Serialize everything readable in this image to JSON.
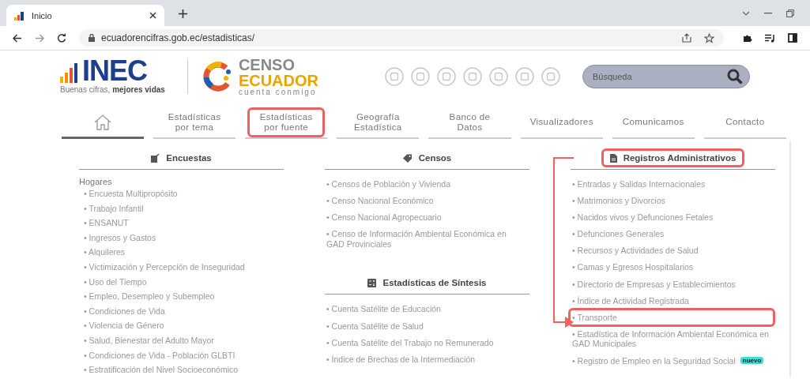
{
  "browser": {
    "tab_title": "Inicio",
    "url": "ecuadorencifras.gob.ec/estadisticas/"
  },
  "header": {
    "logo_text": "INEC",
    "slogan": "Buenas cifras, **mejores vidas**",
    "censo_line1": "CENSO",
    "censo_line2": "ECUADOR",
    "censo_tagline": "cuenta conmigo",
    "search": {
      "placeholder": "Búsqueda"
    }
  },
  "nav": [
    {
      "kind": "home",
      "selected": true
    },
    {
      "kind": "text",
      "label": "Estadísticas por tema",
      "selected": false,
      "highlighted": false
    },
    {
      "kind": "text",
      "label": "Estadísticas por fuente",
      "selected": false,
      "highlighted": true
    },
    {
      "kind": "text",
      "label": "Geografía Estadística",
      "selected": false,
      "highlighted": false
    },
    {
      "kind": "text",
      "label": "Banco de Datos",
      "selected": false,
      "highlighted": false
    },
    {
      "kind": "text",
      "label": "Visualizadores",
      "selected": false,
      "highlighted": false
    },
    {
      "kind": "text",
      "label": "Comunicamos",
      "selected": false,
      "highlighted": false
    },
    {
      "kind": "text",
      "label": "Contacto",
      "selected": false,
      "highlighted": false
    }
  ],
  "columns": [
    {
      "sections": [
        {
          "heading": "Encuestas",
          "highlighted": false,
          "group": "Hogares",
          "items": [
            {
              "label": "• Encuesta Multipropósito",
              "highlighted": false
            },
            {
              "label": "• Trabajo Infantil",
              "highlighted": false
            },
            {
              "label": "• ENSANUT",
              "highlighted": false
            },
            {
              "label": "• Ingresos y Gastos",
              "highlighted": false
            },
            {
              "label": "• Alquileres",
              "highlighted": false
            },
            {
              "label": "• Victimización y Percepción de Inseguridad",
              "highlighted": false
            },
            {
              "label": "• Uso del Tiempo",
              "highlighted": false
            },
            {
              "label": "• Empleo, Desempleo y Subempleo",
              "highlighted": false
            },
            {
              "label": "• Condiciones de Vida",
              "highlighted": false
            },
            {
              "label": "• Violencia de Género",
              "highlighted": false
            },
            {
              "label": "• Salud, Bienestar del Adulto Mayor",
              "highlighted": false
            },
            {
              "label": "• Condiciones de Vida - Población GLBTI",
              "highlighted": false
            },
            {
              "label": "• Estratificación del Nivel Socioeconómico",
              "highlighted": false
            }
          ]
        }
      ]
    },
    {
      "sections": [
        {
          "heading": "Censos",
          "highlighted": false,
          "items": [
            {
              "label": "• Censos de Población y Vivienda",
              "highlighted": false
            },
            {
              "label": "• Censo Nacional Económico",
              "highlighted": false
            },
            {
              "label": "• Censo Nacional Agropecuario",
              "highlighted": false
            },
            {
              "label": "• Censo de Información Ambiental Económica en GAD Provinciales",
              "highlighted": false
            }
          ]
        },
        {
          "heading": "Estadísticas de Síntesis",
          "highlighted": false,
          "items": [
            {
              "label": "• Cuenta Satélite de Educación",
              "highlighted": false
            },
            {
              "label": "• Cuenta Satélite de Salud",
              "highlighted": false
            },
            {
              "label": "• Cuenta Satélite del Trabajo no Remunerado",
              "highlighted": false
            },
            {
              "label": "• Índice de Brechas de la Intermediación",
              "highlighted": false
            }
          ]
        }
      ]
    },
    {
      "sections": [
        {
          "heading": "Registros Administrativos",
          "highlighted": true,
          "items": [
            {
              "label": "• Entradas y Salidas Internacionales",
              "highlighted": false
            },
            {
              "label": "• Matrimonios y Divorcios",
              "highlighted": false
            },
            {
              "label": "• Nacidos vivos y Defunciones Fetales",
              "highlighted": false
            },
            {
              "label": "• Defunciones Generales",
              "highlighted": false
            },
            {
              "label": "• Recursos y Actividades de Salud",
              "highlighted": false
            },
            {
              "label": "• Camas y Egresos Hospitalarios",
              "highlighted": false
            },
            {
              "label": "• Directorio de Empresas y Establecimientos",
              "highlighted": false
            },
            {
              "label": "• Índice de Actividad Registrada",
              "highlighted": false
            },
            {
              "label": "• Transporte",
              "highlighted": true
            },
            {
              "label": "• Estadística de Información Ambiental Económica en GAD Municipales",
              "highlighted": false
            },
            {
              "label": "• Registro de Empleo en la Seguridad Social",
              "highlighted": false,
              "badge": "nuevo"
            }
          ]
        }
      ]
    }
  ]
}
